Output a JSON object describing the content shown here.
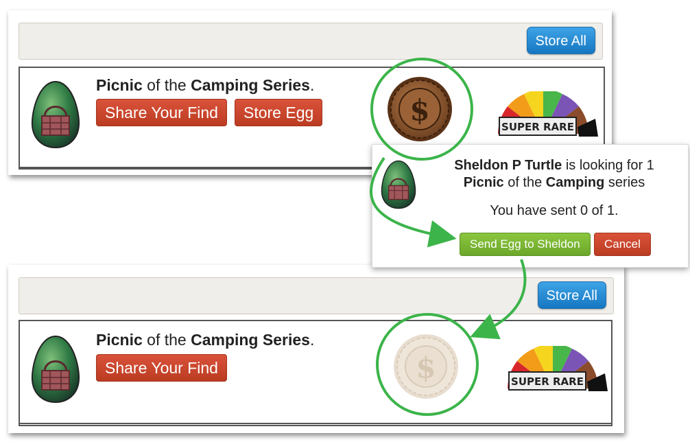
{
  "toolbar": {
    "store_all_label": "Store All"
  },
  "egg_card_before": {
    "name": "Picnic",
    "of_text": " of the ",
    "series_name": "Camping Series",
    "period": ".",
    "share_label": "Share Your Find",
    "store_label": "Store Egg",
    "rarity_label": "SUPER RARE",
    "coin_symbol": "$"
  },
  "egg_card_after": {
    "name": "Picnic",
    "of_text": " of the ",
    "series_name": "Camping Series",
    "period": ".",
    "share_label": "Share Your Find",
    "rarity_label": "SUPER RARE",
    "coin_symbol": "$"
  },
  "popup": {
    "requester": "Sheldon P Turtle",
    "looking_text": " is looking for 1",
    "egg_name": "Picnic",
    "of_the": " of the ",
    "series": "Camping",
    "series_suffix": " series",
    "sent_status": "You have sent 0 of 1.",
    "send_label": "Send Egg to Sheldon",
    "cancel_label": "Cancel"
  },
  "colors": {
    "highlight_green": "#3cb44a",
    "store_blue": "#1677c2",
    "action_red": "#bb3c22",
    "send_green": "#6ba72a"
  },
  "icons": [
    "egg-icon",
    "coin-icon",
    "rarity-meter-icon",
    "arrow-icon"
  ]
}
